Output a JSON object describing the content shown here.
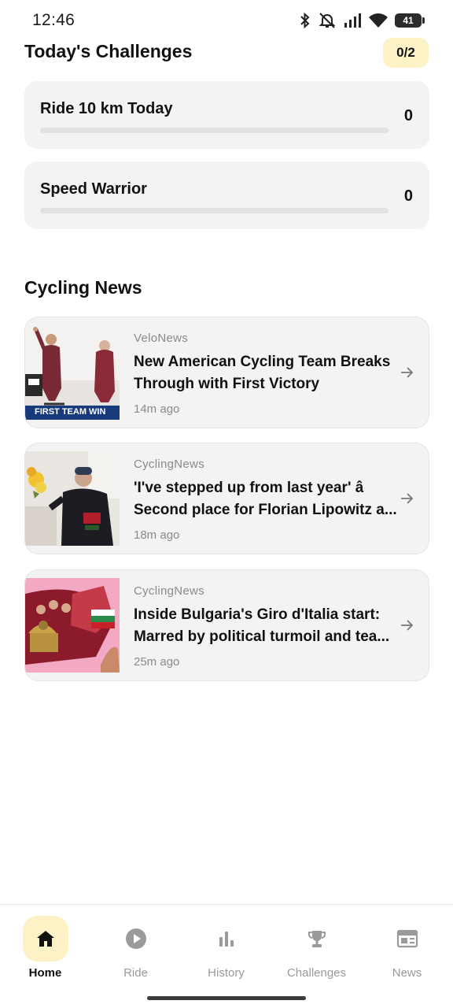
{
  "status_bar": {
    "time": "12:46",
    "battery": "41"
  },
  "challenges": {
    "title": "Today's Challenges",
    "count": "0/2",
    "items": [
      {
        "title": "Ride 10 km Today",
        "value": "0",
        "progress": 0
      },
      {
        "title": "Speed Warrior",
        "value": "0",
        "progress": 0
      }
    ]
  },
  "news": {
    "title": "Cycling News",
    "items": [
      {
        "source": "VeloNews",
        "headline": "New American Cycling Team Breaks Through with First Victory",
        "age": "14m ago",
        "thumb_caption": "FIRST TEAM WIN"
      },
      {
        "source": "CyclingNews",
        "headline": "'I've stepped up from last year' â Second place for Florian Lipowitz a...",
        "age": "18m ago"
      },
      {
        "source": "CyclingNews",
        "headline": "Inside Bulgaria's Giro d'Italia start: Marred by political turmoil and tea...",
        "age": "25m ago"
      }
    ]
  },
  "nav": {
    "items": [
      {
        "label": "Home",
        "icon": "home-icon",
        "active": true
      },
      {
        "label": "Ride",
        "icon": "play-circle-icon",
        "active": false
      },
      {
        "label": "History",
        "icon": "bar-chart-icon",
        "active": false
      },
      {
        "label": "Challenges",
        "icon": "trophy-icon",
        "active": false
      },
      {
        "label": "News",
        "icon": "newspaper-icon",
        "active": false
      }
    ]
  },
  "colors": {
    "accent": "#f5c400",
    "badge_bg": "#fbf3c6",
    "card_bg": "#f3f3f3"
  }
}
